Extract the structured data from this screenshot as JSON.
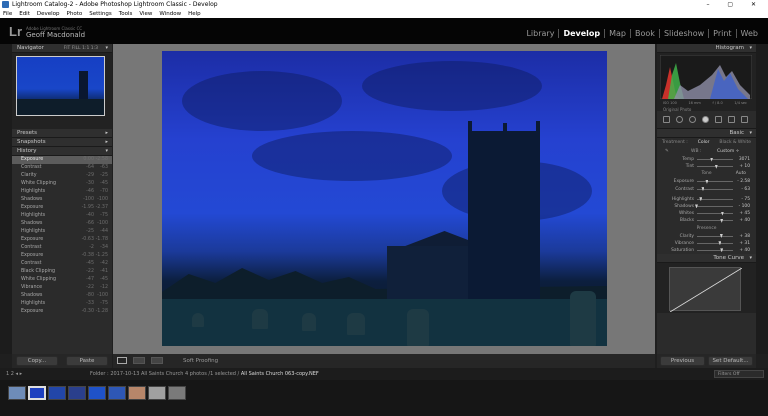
{
  "window": {
    "title": "Lightroom Catalog-2 - Adobe Photoshop Lightroom Classic - Develop",
    "controls": "–  ▢  ✕"
  },
  "menu": [
    "File",
    "Edit",
    "Develop",
    "Photo",
    "Settings",
    "Tools",
    "View",
    "Window",
    "Help"
  ],
  "identity": {
    "logo": "Lr",
    "product": "Adobe Lightroom Classic CC",
    "user": "Geoff Macdonald"
  },
  "modules": [
    {
      "label": "Library",
      "active": false
    },
    {
      "label": "Develop",
      "active": true
    },
    {
      "label": "Map",
      "active": false
    },
    {
      "label": "Book",
      "active": false
    },
    {
      "label": "Slideshow",
      "active": false
    },
    {
      "label": "Print",
      "active": false
    },
    {
      "label": "Web",
      "active": false
    }
  ],
  "left": {
    "navigator": {
      "label": "Navigator",
      "zoom": "FIT  FILL  1:1  1:3"
    },
    "presets": "Presets",
    "snapshots": "Snapshots",
    "history": {
      "label": "History",
      "items": [
        {
          "name": "Exposure",
          "a": "0.00",
          "b": "-2.58",
          "selected": true
        },
        {
          "name": "Contrast",
          "a": "-64",
          "b": "-63"
        },
        {
          "name": "Clarity",
          "a": "-29",
          "b": "-25"
        },
        {
          "name": "White Clipping",
          "a": "-30",
          "b": "-45"
        },
        {
          "name": "Highlights",
          "a": "-46",
          "b": "-70"
        },
        {
          "name": "Shadows",
          "a": "-100",
          "b": "-100"
        },
        {
          "name": "Exposure",
          "a": "-1.95",
          "b": "-2.37"
        },
        {
          "name": "Highlights",
          "a": "-40",
          "b": "-75"
        },
        {
          "name": "Shadows",
          "a": "-66",
          "b": "-100"
        },
        {
          "name": "Highlights",
          "a": "-25",
          "b": "-44"
        },
        {
          "name": "Exposure",
          "a": "-0.63",
          "b": "-1.78"
        },
        {
          "name": "Contrast",
          "a": "-2",
          "b": "-34"
        },
        {
          "name": "Exposure",
          "a": "-0.38",
          "b": "-1.25"
        },
        {
          "name": "Contrast",
          "a": "-45",
          "b": "-42"
        },
        {
          "name": "Black Clipping",
          "a": "-22",
          "b": "-41"
        },
        {
          "name": "White Clipping",
          "a": "-47",
          "b": "-45"
        },
        {
          "name": "Vibrance",
          "a": "-22",
          "b": "-12"
        },
        {
          "name": "Shadows",
          "a": "-80",
          "b": "-100"
        },
        {
          "name": "Highlights",
          "a": "-33",
          "b": "-75"
        },
        {
          "name": "Exposure",
          "a": "-0.30",
          "b": "-1.28"
        }
      ]
    },
    "copy_label": "Copy...",
    "paste_label": "Paste"
  },
  "toolbar": {
    "soft_proofing": "Soft Proofing",
    "yy": "Y|Y"
  },
  "right": {
    "histogram": {
      "label": "Histogram",
      "iso": "ISO 100",
      "focal": "16 mm",
      "fstop": "f / 8.0",
      "shutter": "1/4 sec",
      "original_photo": "Original Photo"
    },
    "basic": {
      "label": "Basic",
      "treatment": [
        "Treatment :",
        "Color",
        "Black & White"
      ],
      "wb_label": "WB :",
      "wb_value": "Custom ÷",
      "wb_sliders": [
        {
          "label": "Temp",
          "value": "3071",
          "pos": 0.42
        },
        {
          "label": "Tint",
          "value": "+ 10",
          "pos": 0.55
        }
      ],
      "tone_label": "Tone",
      "auto_label": "Auto",
      "tone_sliders": [
        {
          "label": "Exposure",
          "value": "- 2.58",
          "pos": 0.29
        },
        {
          "label": "Contrast",
          "value": "- 63",
          "pos": 0.18
        }
      ],
      "tone2_sliders": [
        {
          "label": "Highlights",
          "value": "- 75",
          "pos": 0.12
        },
        {
          "label": "Shadows",
          "value": "- 100",
          "pos": 0.0
        },
        {
          "label": "Whites",
          "value": "+ 45",
          "pos": 0.72
        },
        {
          "label": "Blacks",
          "value": "+ 40",
          "pos": 0.7
        }
      ],
      "presence_label": "Presence",
      "presence_sliders": [
        {
          "label": "Clarity",
          "value": "+ 38",
          "pos": 0.69
        },
        {
          "label": "Vibrance",
          "value": "+ 31",
          "pos": 0.65
        },
        {
          "label": "Saturation",
          "value": "+ 40",
          "pos": 0.7
        }
      ]
    },
    "tone_curve": "Tone Curve",
    "previous_label": "Previous",
    "reset_label": "Set Default..."
  },
  "filmbar": {
    "nav": "1  2   ◂  ▸",
    "folder": "Folder : 2017-10-13 All Saints Church",
    "count": "4 photos /1 selected /",
    "filename": "All Saints Church 063-copy.NEF",
    "filter_label": "Filter :",
    "filter_value": "Filters Off"
  }
}
